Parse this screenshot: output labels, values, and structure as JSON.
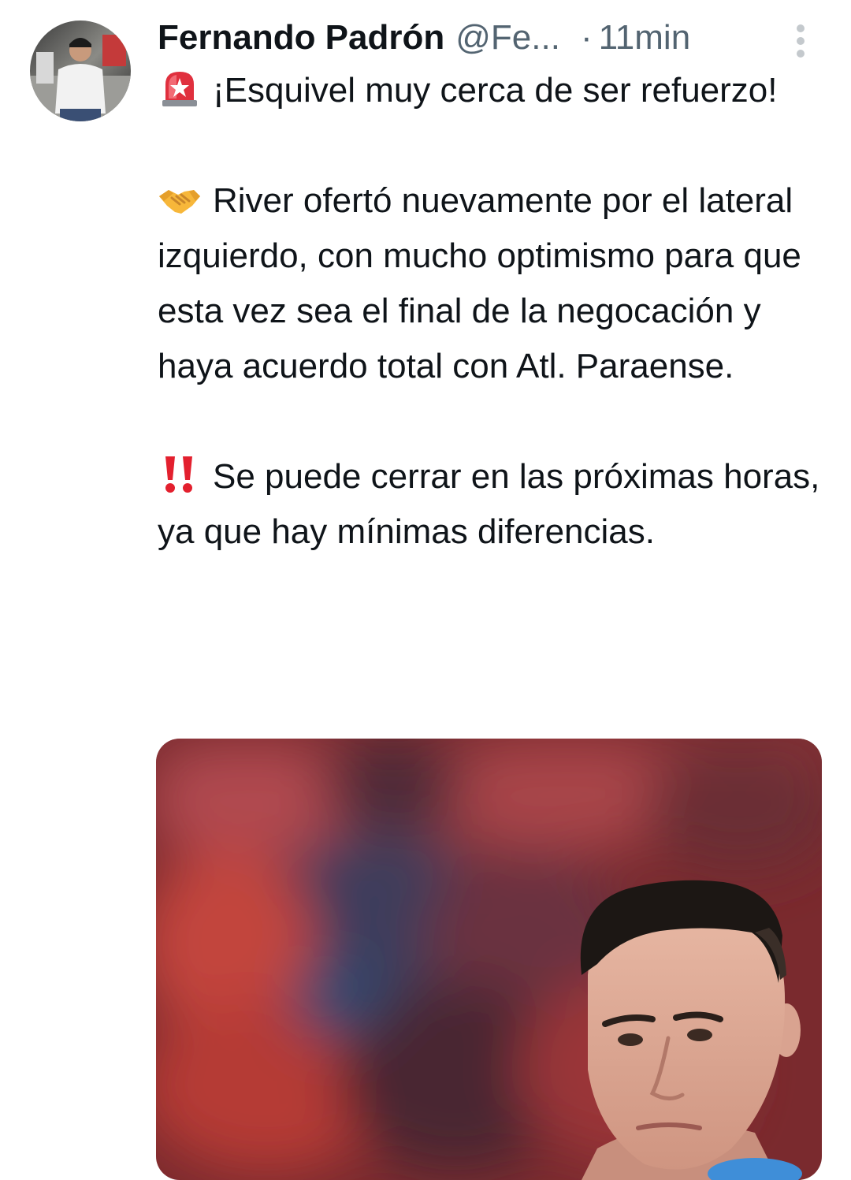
{
  "tweet": {
    "author": {
      "display_name": "Fernando Padrón",
      "handle": "@Fe...",
      "avatar_icon": "profile-photo"
    },
    "separator": "·",
    "timestamp": "11min",
    "more_icon": "more-vertical-icon",
    "paragraphs": [
      {
        "emoji": "rotating-light-icon",
        "text": "¡Esquivel muy cerca de ser refuerzo!"
      },
      {
        "emoji": "handshake-icon",
        "text": "River ofertó nuevamente por el lateral izquierdo, con mucho optimismo para que esta vez sea el final de la negocación y haya acuerdo total con Atl. Paraense."
      },
      {
        "emoji": "double-exclamation-icon",
        "text": "Se puede cerrar en las próximas horas, ya que hay mínimas diferencias."
      }
    ],
    "media": {
      "type": "photo",
      "icon": "player-photo"
    }
  },
  "colors": {
    "text_primary": "#0f1419",
    "text_secondary": "#536471",
    "background": "#ffffff"
  }
}
